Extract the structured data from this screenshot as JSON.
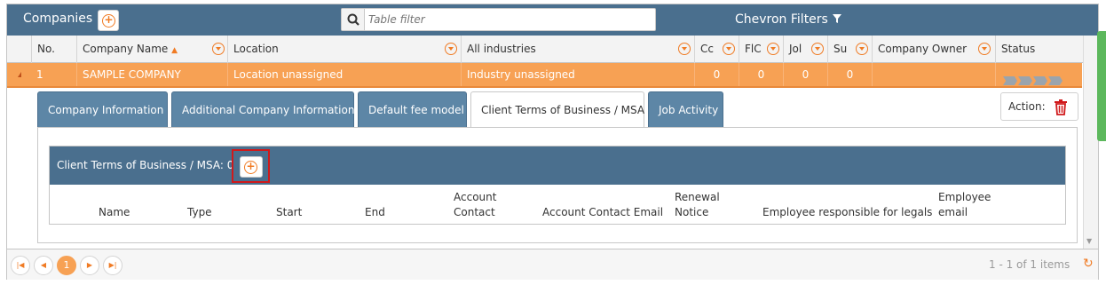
{
  "header": {
    "title": "Companies",
    "filter_placeholder": "Table filter",
    "chevron_filters": "Chevron Filters"
  },
  "columns": {
    "no": "No.",
    "company_name": "Company Name",
    "location": "Location",
    "industries": "All industries",
    "cc": "Cc",
    "fl": "FlϹ",
    "jo": "Jol",
    "su": "Su",
    "owner": "Company Owner",
    "status": "Status"
  },
  "row": {
    "no": "1",
    "company_name": "SAMPLE COMPANY",
    "location": "Location unassigned",
    "industry": "Industry unassigned",
    "cc": "0",
    "fl": "0",
    "jo": "0",
    "su": "0"
  },
  "tabs": [
    {
      "label": "Company Information"
    },
    {
      "label": "Additional Company Information"
    },
    {
      "label": "Default fee model"
    },
    {
      "label": "Client Terms of Business / MSA"
    },
    {
      "label": "Job Activity"
    }
  ],
  "action": {
    "label": "Action:"
  },
  "msa": {
    "title": "Client Terms of Business / MSA: 0",
    "columns": {
      "name": "Name",
      "type": "Type",
      "start": "Start",
      "end": "End",
      "account_contact_1": "Account",
      "account_contact_2": "Contact",
      "account_contact_email": "Account Contact Email",
      "renewal_1": "Renewal",
      "renewal_2": "Notice",
      "employee_legals": "Employee responsible for legals",
      "employee_email_1": "Employee",
      "employee_email_2": "email"
    }
  },
  "pager": {
    "current_page": "1",
    "info": "1 - 1 of 1 items"
  },
  "colors": {
    "header_bg": "#4a6f8e",
    "accent": "#f07b24",
    "selected_row": "#f7a154",
    "delete": "#d0191b"
  }
}
